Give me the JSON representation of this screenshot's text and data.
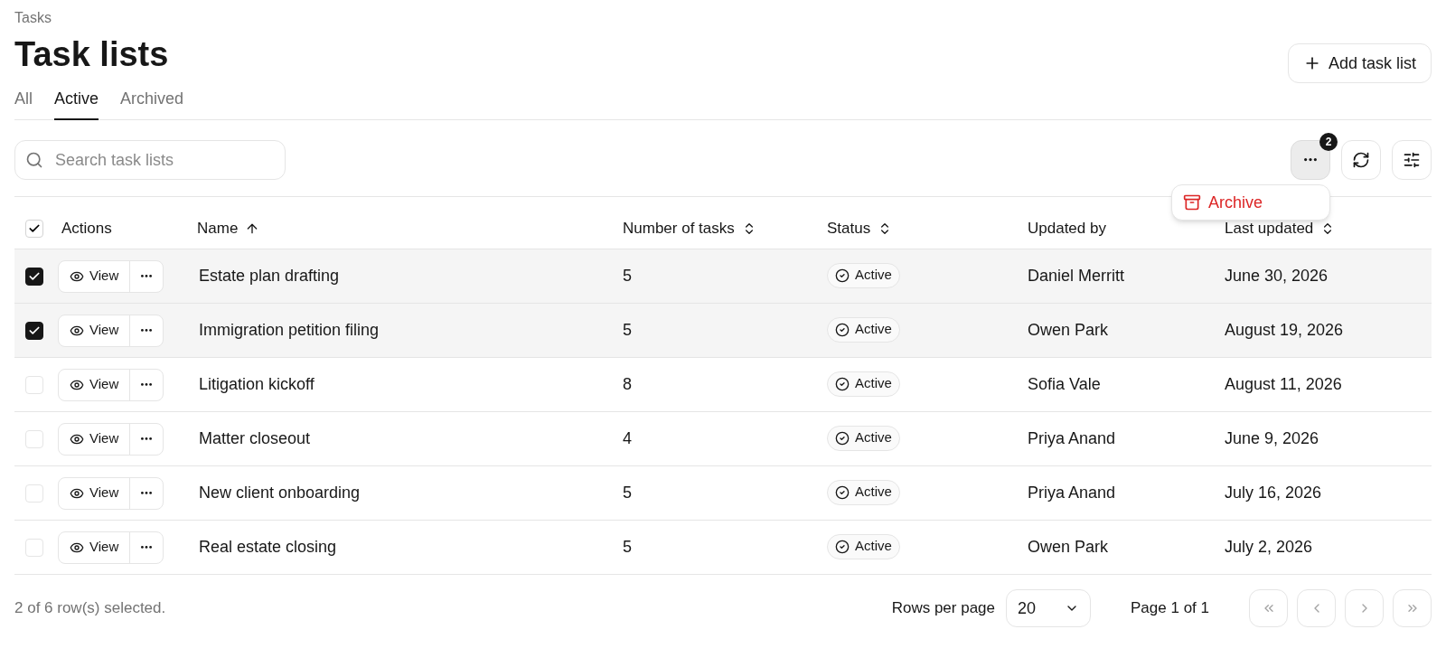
{
  "breadcrumb": "Tasks",
  "title": "Task lists",
  "add_button": "Add task list",
  "tabs": [
    {
      "label": "All",
      "selected": false
    },
    {
      "label": "Active",
      "selected": true
    },
    {
      "label": "Archived",
      "selected": false
    }
  ],
  "search": {
    "placeholder": "Search task lists"
  },
  "bulk_actions": {
    "badge": "2",
    "expanded": true,
    "menu": [
      {
        "label": "Archive",
        "kind": "danger"
      }
    ]
  },
  "table": {
    "select_all": {
      "checked": true
    },
    "columns": [
      {
        "label": "Actions",
        "kind": "plain"
      },
      {
        "label": "Name",
        "kind": "sorted_ascending"
      },
      {
        "label": "Number of tasks",
        "kind": "sortable"
      },
      {
        "label": "Status",
        "kind": "sortable"
      },
      {
        "label": "Updated by",
        "kind": "plain"
      },
      {
        "label": "Last updated",
        "kind": "sortable"
      }
    ],
    "rows": [
      {
        "selected": true,
        "view": "View",
        "name": "Estate plan drafting",
        "tasks": "5",
        "status": "Active",
        "updated_by": "Daniel Merritt",
        "last_updated": "June 30, 2026"
      },
      {
        "selected": true,
        "view": "View",
        "name": "Immigration petition filing",
        "tasks": "5",
        "status": "Active",
        "updated_by": "Owen Park",
        "last_updated": "August 19, 2026"
      },
      {
        "selected": false,
        "view": "View",
        "name": "Litigation kickoff",
        "tasks": "8",
        "status": "Active",
        "updated_by": "Sofia Vale",
        "last_updated": "August 11, 2026"
      },
      {
        "selected": false,
        "view": "View",
        "name": "Matter closeout",
        "tasks": "4",
        "status": "Active",
        "updated_by": "Priya Anand",
        "last_updated": "June 9, 2026"
      },
      {
        "selected": false,
        "view": "View",
        "name": "New client onboarding",
        "tasks": "5",
        "status": "Active",
        "updated_by": "Priya Anand",
        "last_updated": "July 16, 2026"
      },
      {
        "selected": false,
        "view": "View",
        "name": "Real estate closing",
        "tasks": "5",
        "status": "Active",
        "updated_by": "Owen Park",
        "last_updated": "July 2, 2026"
      }
    ]
  },
  "footer": {
    "selection": "2 of 6 row(s) selected.",
    "rows_per_page_label": "Rows per page",
    "rows_per_page": "20",
    "page": "Page 1 of 1",
    "pager": [
      {
        "kind": "first",
        "disabled": true
      },
      {
        "kind": "prev",
        "disabled": true
      },
      {
        "kind": "next",
        "disabled": true
      },
      {
        "kind": "last",
        "disabled": true
      }
    ]
  }
}
